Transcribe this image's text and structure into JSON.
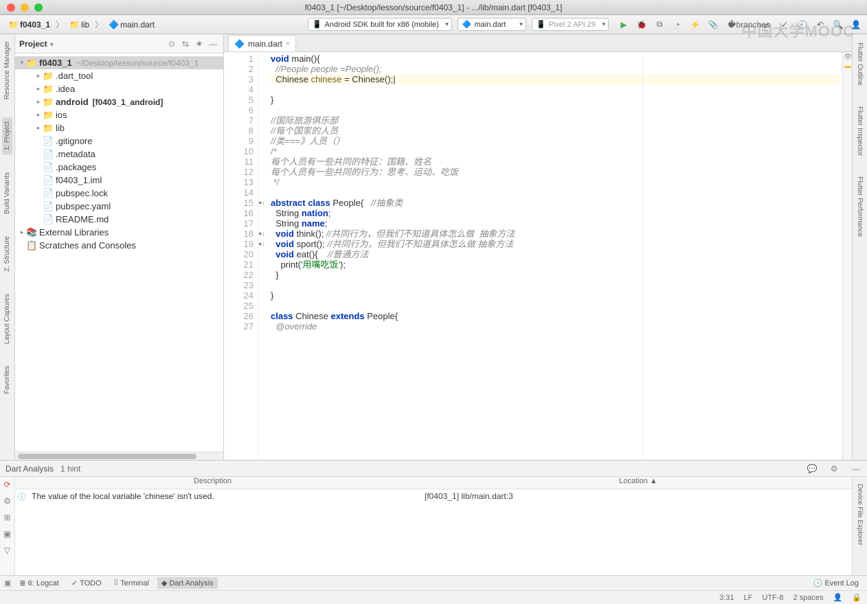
{
  "window": {
    "title": "f0403_1 [~/Desktop/lesson/source/f0403_1] - .../lib/main.dart [f0403_1]"
  },
  "breadcrumb": {
    "project": "f0403_1",
    "folder": "lib",
    "file": "main.dart"
  },
  "toolbar": {
    "device": "Android SDK built for x86 (mobile)",
    "config": "main.dart",
    "target": "Pixel 2 API 29"
  },
  "watermark": "中国大学MOOC",
  "project_panel": {
    "title": "Project",
    "root": {
      "name": "f0403_1",
      "path": "~/Desktop/lesson/source/f0403_1"
    },
    "items": [
      {
        "label": ".dart_tool",
        "indent": 1,
        "arrow": "▸",
        "icon": "📁",
        "color": "#b08b4f"
      },
      {
        "label": ".idea",
        "indent": 1,
        "arrow": "▸",
        "icon": "📁"
      },
      {
        "label": "android",
        "extras": "[f0403_1_android]",
        "indent": 1,
        "arrow": "▸",
        "icon": "📁",
        "bold": true
      },
      {
        "label": "ios",
        "indent": 1,
        "arrow": "▸",
        "icon": "📁"
      },
      {
        "label": "lib",
        "indent": 1,
        "arrow": "▸",
        "icon": "📁"
      },
      {
        "label": ".gitignore",
        "indent": 1,
        "arrow": "",
        "icon": "📄"
      },
      {
        "label": ".metadata",
        "indent": 1,
        "arrow": "",
        "icon": "📄"
      },
      {
        "label": ".packages",
        "indent": 1,
        "arrow": "",
        "icon": "📄"
      },
      {
        "label": "f0403_1.iml",
        "indent": 1,
        "arrow": "",
        "icon": "📄"
      },
      {
        "label": "pubspec.lock",
        "indent": 1,
        "arrow": "",
        "icon": "📄"
      },
      {
        "label": "pubspec.yaml",
        "indent": 1,
        "arrow": "",
        "icon": "📄"
      },
      {
        "label": "README.md",
        "indent": 1,
        "arrow": "",
        "icon": "📄"
      }
    ],
    "ext_lib": "External Libraries",
    "scratches": "Scratches and Consoles"
  },
  "editor": {
    "tab": "main.dart",
    "lines": [
      {
        "n": 1,
        "html": "<span class='kw'>void</span> <span class='fn'>main</span>(){"
      },
      {
        "n": 2,
        "html": "  <span class='cm'>//People people =People();</span>"
      },
      {
        "n": 3,
        "html": "  <span class='cls'>Chinese</span> <span class='var'>chinese</span> = <span class='cls'>Chinese</span>();<span class='cursor'>|</span>",
        "hl": true
      },
      {
        "n": 4,
        "html": ""
      },
      {
        "n": 5,
        "html": "}"
      },
      {
        "n": 6,
        "html": ""
      },
      {
        "n": 7,
        "html": "<span class='cm'>//国际旅游俱乐部</span>"
      },
      {
        "n": 8,
        "html": "<span class='cm'>//每个国家的人员</span>"
      },
      {
        "n": 9,
        "html": "<span class='cm'>//类===》人员（）</span>"
      },
      {
        "n": 10,
        "html": "<span class='cm'>/*</span>"
      },
      {
        "n": 11,
        "html": "<span class='cm'>每个人员有一些共同的特征：国籍、姓名</span>"
      },
      {
        "n": 12,
        "html": "<span class='cm'>每个人员有一些共同的行为：思考、运动、吃饭</span>"
      },
      {
        "n": 13,
        "html": "<span class='cm'> */</span>"
      },
      {
        "n": 14,
        "html": ""
      },
      {
        "n": 15,
        "html": "<span class='kw'>abstract</span> <span class='kw'>class</span> <span class='cls'>People</span>{   <span class='cm'>//抽象类</span>",
        "mark": "●↓"
      },
      {
        "n": 16,
        "html": "  <span class='cls'>String</span> <span class='kw'>nation</span>;"
      },
      {
        "n": 17,
        "html": "  <span class='cls'>String</span> <span class='kw'>name</span>;"
      },
      {
        "n": 18,
        "html": "  <span class='kw'>void</span> think(); <span class='cm'>//共同行为，但我们不知道具体怎么做  抽象方法</span>",
        "mark": "●↓"
      },
      {
        "n": 19,
        "html": "  <span class='kw'>void</span> sport(); <span class='cm'>//共同行为，但我们不知道具体怎么做 抽象方法</span>",
        "mark": "●↓"
      },
      {
        "n": 20,
        "html": "  <span class='kw'>void</span> eat(){    <span class='cm'>//普通方法</span>"
      },
      {
        "n": 21,
        "html": "    print(<span class='str'>'用嘴吃饭'</span>);"
      },
      {
        "n": 22,
        "html": "  }"
      },
      {
        "n": 23,
        "html": ""
      },
      {
        "n": 24,
        "html": "}"
      },
      {
        "n": 25,
        "html": ""
      },
      {
        "n": 26,
        "html": "<span class='kw'>class</span> <span class='cls'>Chinese</span> <span class='kw'>extends</span> <span class='cls'>People</span>{"
      },
      {
        "n": 27,
        "html": "  <span class='cm'>@override</span>"
      }
    ]
  },
  "analysis": {
    "title": "Dart Analysis",
    "hint": "1 hint",
    "col_desc": "Description",
    "col_loc": "Location",
    "rows": [
      {
        "desc": "The value of the local variable 'chinese' isn't used.",
        "loc": "[f0403_1] lib/main.dart:3"
      }
    ]
  },
  "bottom_tabs": {
    "logcat": "6: Logcat",
    "todo": "TODO",
    "terminal": "Terminal",
    "dart": "Dart Analysis",
    "eventlog": "Event Log"
  },
  "left_gutter": {
    "t1": "Resource Manager",
    "t2": "1: Project",
    "t3": "Build Variants",
    "t4": "2. Structure",
    "t5": "Layout Captures",
    "t6": "Favorites"
  },
  "right_gutter": {
    "t1": "Flutter Outline",
    "t2": "Flutter Inspector",
    "t3": "Flutter Performance",
    "t4": "Device File Explorer"
  },
  "status": {
    "pos": "3:31",
    "le": "LF",
    "enc": "UTF-8",
    "indent": "2 spaces"
  }
}
